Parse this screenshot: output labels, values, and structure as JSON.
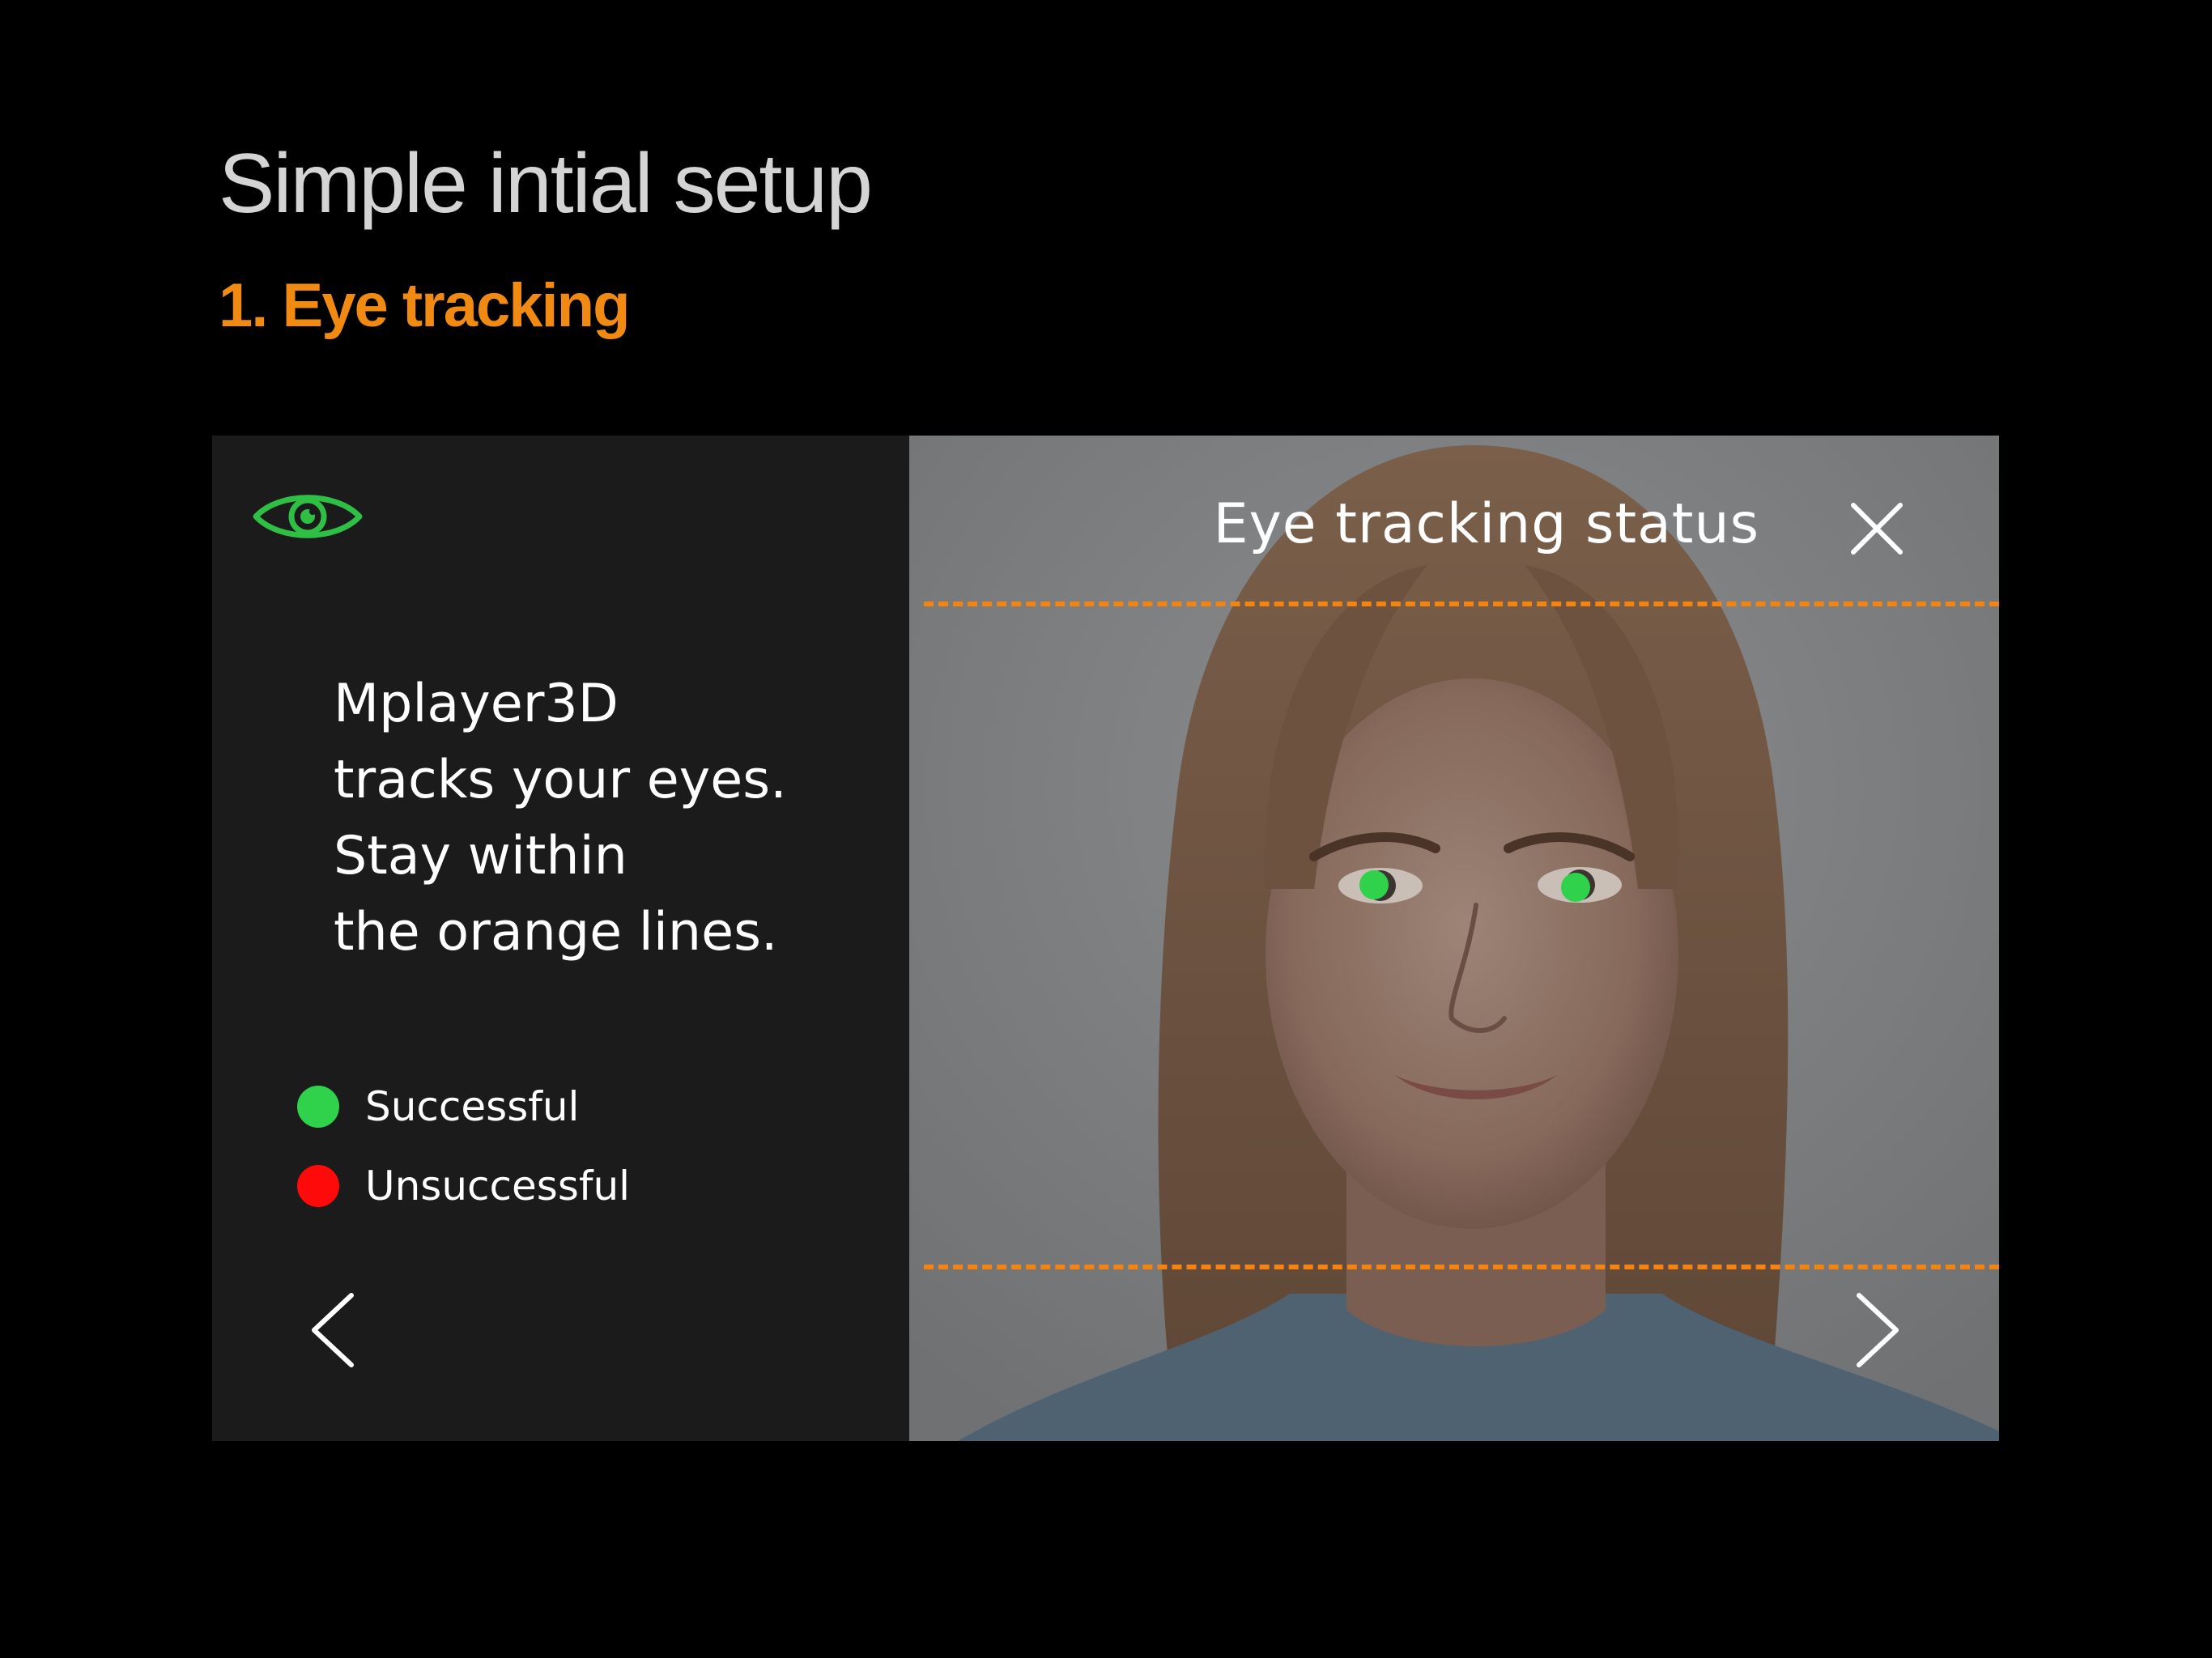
{
  "header": {
    "title": "Simple intial setup",
    "subtitle": "1. Eye tracking"
  },
  "left_panel": {
    "icon": "eye-icon",
    "instruction_lines": [
      "Mplayer3D",
      "tracks your eyes.",
      "Stay within",
      "the orange lines."
    ],
    "legend": [
      {
        "label": "Successful",
        "color": "#2fd24a"
      },
      {
        "label": "Unsuccessful",
        "color": "#ff0a0a"
      }
    ],
    "prev_icon": "chevron-left-icon"
  },
  "right_panel": {
    "status_title": "Eye tracking status",
    "close_icon": "close-icon",
    "next_icon": "chevron-right-icon",
    "guide_line_color": "#f5830f",
    "eye_marker_color": "#2fd24a"
  }
}
